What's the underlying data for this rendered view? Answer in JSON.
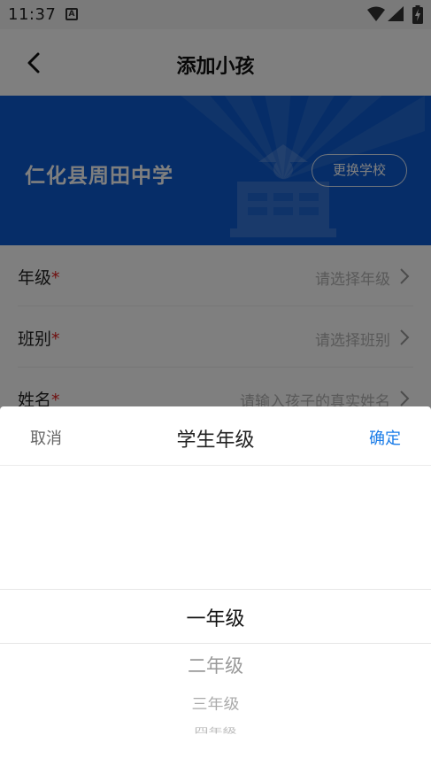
{
  "status_bar": {
    "time": "11:37",
    "notification_icon": "a-square-icon",
    "icons": [
      "wifi-icon",
      "signal-icon",
      "battery-charging-icon"
    ]
  },
  "header": {
    "title": "添加小孩",
    "back_icon": "chevron-left-icon"
  },
  "banner": {
    "school_name": "仁化县周田中学",
    "change_school_label": "更换学校",
    "background_color": "#0d5bd0"
  },
  "form": {
    "rows": [
      {
        "label": "年级",
        "required_mark": "*",
        "placeholder": "请选择年级"
      },
      {
        "label": "班别",
        "required_mark": "*",
        "placeholder": "请选择班别"
      },
      {
        "label": "姓名",
        "required_mark": "*",
        "placeholder": "请输入孩子的真实姓名"
      }
    ]
  },
  "picker": {
    "cancel_label": "取消",
    "title": "学生年级",
    "confirm_label": "确定",
    "confirm_color": "#1a7ce8",
    "selected": "一年级",
    "options": [
      "一年级",
      "二年级",
      "三年级",
      "四年级"
    ]
  }
}
